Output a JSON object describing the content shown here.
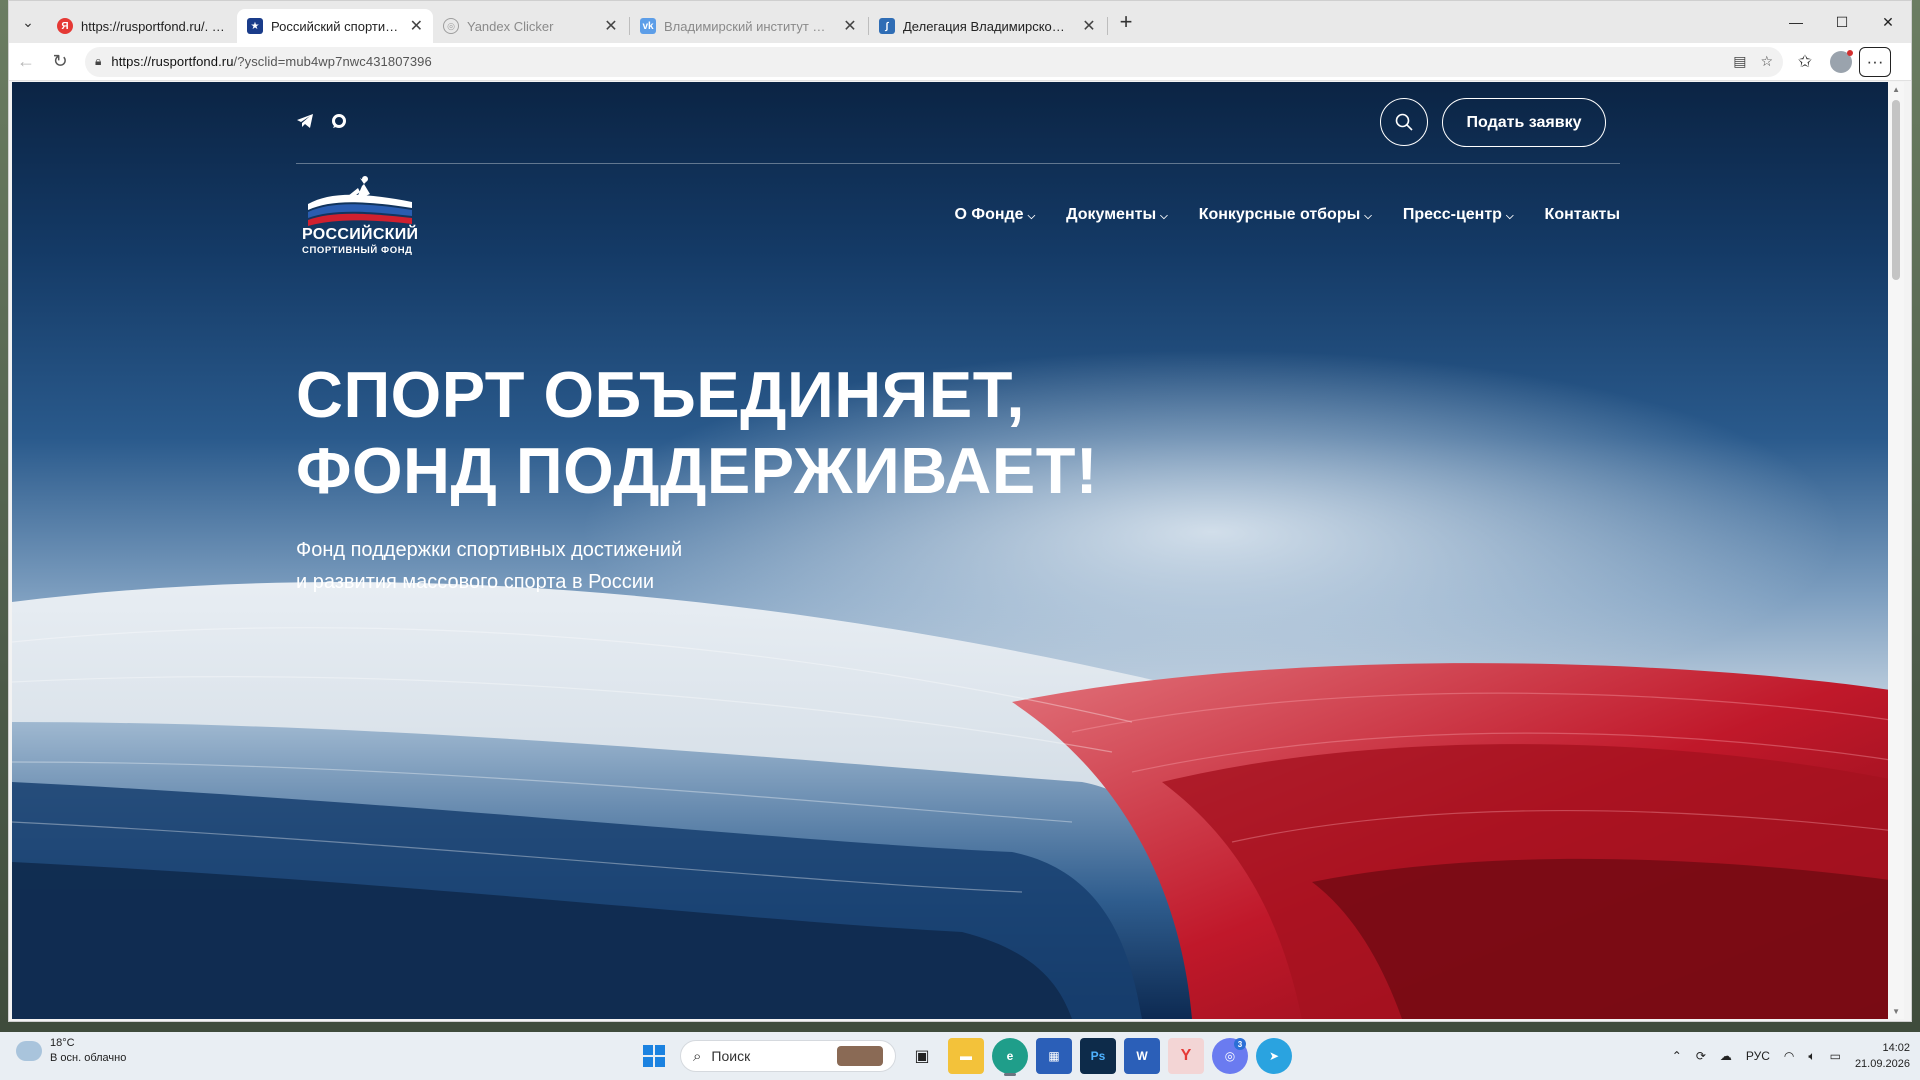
{
  "browser": {
    "tabs": [
      {
        "title": "https://rusportfond.ru/. — Яндекс",
        "favicon": "yandex-icon",
        "color": "#e53935",
        "active": false,
        "dim": false
      },
      {
        "title": "Российский спортивный фонд",
        "favicon": "rsf-icon",
        "color": "#1a3c8a",
        "active": true,
        "dim": false
      },
      {
        "title": "Yandex Clicker",
        "favicon": "globe-icon",
        "color": "#9e9e9e",
        "active": false,
        "dim": true
      },
      {
        "title": "Владимирский институт развити",
        "favicon": "vk-icon",
        "color": "#5d9ee8",
        "active": false,
        "dim": true
      },
      {
        "title": "Делегация Владимирской облас",
        "favicon": "delegation-icon",
        "color": "#2f6db5",
        "active": false,
        "dim": false
      }
    ],
    "url_host": "https://rusportfond.ru",
    "url_path": "/?ysclid=mub4wp7nwc431807396"
  },
  "site": {
    "apply_label": "Подать заявку",
    "logo_line1": "РОССИЙСКИЙ",
    "logo_line2": "СПОРТИВНЫЙ ФОНД",
    "menu": [
      {
        "label": "О Фонде",
        "dropdown": true
      },
      {
        "label": "Документы",
        "dropdown": true
      },
      {
        "label": "Конкурсные отборы",
        "dropdown": true
      },
      {
        "label": "Пресс-центр",
        "dropdown": true
      },
      {
        "label": "Контакты",
        "dropdown": false
      }
    ],
    "hero_line1": "СПОРТ ОБЪЕДИНЯЕТ,",
    "hero_line2": "ФОНД ПОДДЕРЖИВАЕТ!",
    "sub_line1": "Фонд поддержки спортивных достижений",
    "sub_line2": "и развития массового спорта в России"
  },
  "taskbar": {
    "temp": "18°C",
    "weather": "В осн. облачно",
    "search_placeholder": "Поиск",
    "lang": "РУС",
    "time": "14:02",
    "date": "21.09.2026",
    "badge_count": "3"
  },
  "colors": {
    "accent_red": "#c0182a",
    "accent_blue": "#143a66"
  }
}
